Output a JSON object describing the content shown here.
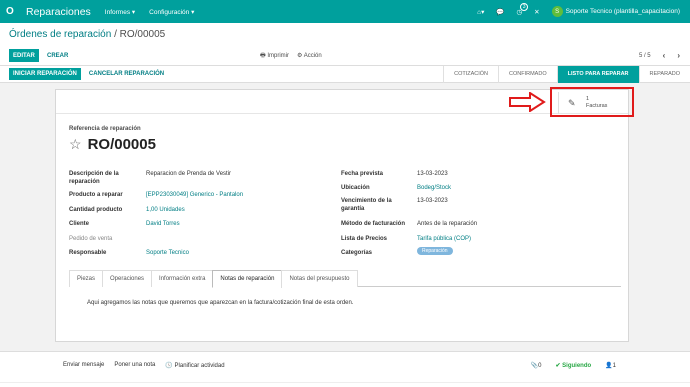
{
  "navbar": {
    "apps_icon": "O",
    "brand": "Reparaciones",
    "menus": [
      "Informes ▾",
      "Configuración ▾"
    ],
    "user_initial": "S",
    "user_name": "Soporte Tecnico (plantilla_capacitacion)",
    "activity_count": "3",
    "brand_color": "#00a09d"
  },
  "control_panel": {
    "breadcrumb_parent": "Órdenes de reparación",
    "breadcrumb_sep": " / ",
    "breadcrumb_current": "RO/00005",
    "edit_label": "EDITAR",
    "create_label": "CREAR",
    "print_label": "🖶 Imprimir",
    "action_label": "⚙ Acción",
    "pager": "5 / 5"
  },
  "statusbar": {
    "start_repair": "INICIAR REPARACIÓN",
    "cancel_repair": "CANCELAR REPARACIÓN",
    "stages": [
      "COTIZACIÓN",
      "CONFIRMADO",
      "LISTO PARA REPARAR",
      "REPARADO"
    ],
    "active_stage": "LISTO PARA REPARAR"
  },
  "smart_button": {
    "count": "1",
    "label": "Facturas",
    "icon": "edit-icon"
  },
  "form": {
    "ref_label": "Referencia de reparación",
    "ref_value": "RO/00005",
    "left_fields": [
      {
        "label": "Descripción de la reparación",
        "value": "Reparacion de Prenda de Vestir"
      },
      {
        "label": "Producto a reparar",
        "value": "[EPP23030049] Generico - Pantalon"
      },
      {
        "label": "Cantidad producto",
        "value": "1,00 Unidades"
      },
      {
        "label": "Cliente",
        "value": "David Torres"
      },
      {
        "label": "Pedido de venta",
        "value": ""
      },
      {
        "label": "Responsable",
        "value": "Soporte Tecnico"
      }
    ],
    "right_fields": [
      {
        "label": "Fecha prevista",
        "value": "13-03-2023"
      },
      {
        "label": "Ubicación",
        "value": "Bodeg/Stock"
      },
      {
        "label": "Vencimiento de la garantía",
        "value": "13-03-2023"
      },
      {
        "label": "Método de facturación",
        "value": "Antes de la reparación"
      },
      {
        "label": "Lista de Precios",
        "value": "Tarifa pública (COP)"
      },
      {
        "label": "Categorías",
        "value": "Reparación"
      }
    ],
    "tabs": [
      "Piezas",
      "Operaciones",
      "Información extra",
      "Notas de reparación",
      "Notas del presupuesto"
    ],
    "active_tab": "Notas de reparación",
    "notes": "Aqui agregamos las notas que queremos que aparezcan en la factura/cotización final de esta orden."
  },
  "chatter": {
    "send_message": "Enviar mensaje",
    "log_note": "Poner una nota",
    "schedule_activity": "🕓 Planificar actividad",
    "attachments": "📎0",
    "following": "✔ Siguiendo",
    "followers": "👤1"
  }
}
